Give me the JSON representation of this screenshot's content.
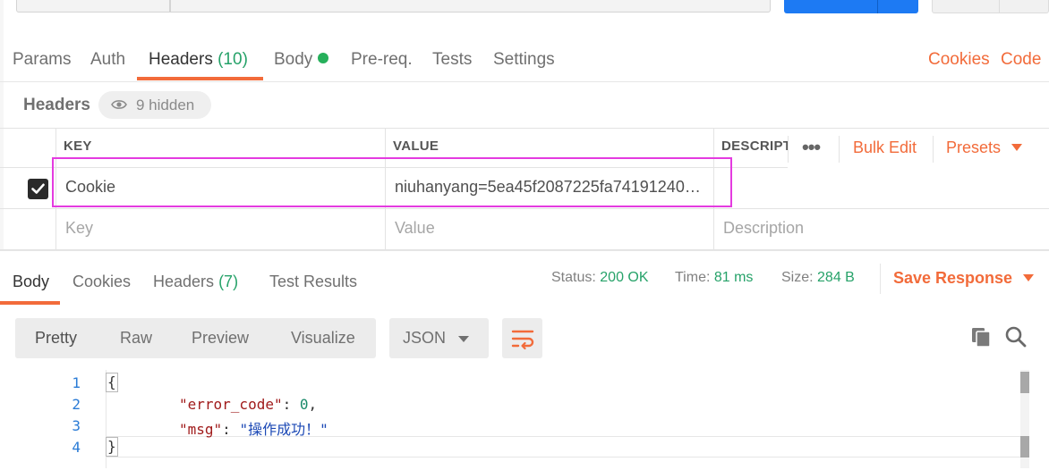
{
  "request_tabs": {
    "params": "Params",
    "auth": "Auth",
    "headers": "Headers",
    "headers_count": "(10)",
    "body": "Body",
    "prereq": "Pre-req.",
    "tests": "Tests",
    "settings": "Settings",
    "cookies_link": "Cookies",
    "code_link": "Code"
  },
  "headers_section": {
    "title": "Headers",
    "hidden_label": "9 hidden"
  },
  "table": {
    "col_key": "KEY",
    "col_value": "VALUE",
    "col_desc": "DESCRIPTI",
    "more": "•••",
    "bulk_edit": "Bulk Edit",
    "presets": "Presets",
    "rows": [
      {
        "key": "Cookie",
        "value": "niuhanyang=5ea45f2087225fa74191240…",
        "checked": true
      }
    ],
    "placeholder": {
      "key": "Key",
      "value": "Value",
      "description": "Description"
    }
  },
  "response_tabs": {
    "body": "Body",
    "cookies": "Cookies",
    "headers": "Headers",
    "headers_count": "(7)",
    "test_results": "Test Results"
  },
  "status": {
    "status_label": "Status:",
    "status_value": "200 OK",
    "time_label": "Time:",
    "time_value": "81 ms",
    "size_label": "Size:",
    "size_value": "284 B",
    "save_response": "Save Response"
  },
  "view_modes": [
    "Pretty",
    "Raw",
    "Preview",
    "Visualize"
  ],
  "format": "JSON",
  "code": {
    "line_numbers": [
      "1",
      "2",
      "3",
      "4"
    ],
    "open_brace": "{",
    "close_brace": "}",
    "k1": "\"error_code\"",
    "v1": "0",
    "k2": "\"msg\"",
    "v2": "\"操作成功！\""
  },
  "colors": {
    "accent": "#f26b3a",
    "success": "#26a269",
    "highlight": "#e43be0",
    "send_blue": "#1d7af3"
  },
  "icons": [
    "eye-icon",
    "checkbox-check-icon",
    "caret-down-icon",
    "wrap-lines-icon",
    "copy-icon",
    "search-icon"
  ]
}
